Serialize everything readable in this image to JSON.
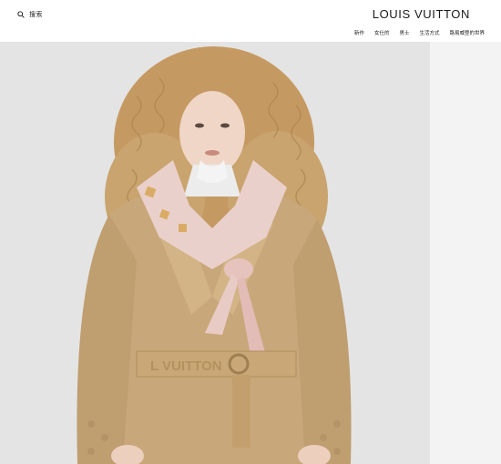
{
  "header": {
    "search_label": "搜索",
    "logo_text": "LOUIS VUITTON",
    "nav": [
      {
        "label": "新作"
      },
      {
        "label": "女仕的"
      },
      {
        "label": "男士"
      },
      {
        "label": "生活方式"
      },
      {
        "label": "路易威登的世界"
      }
    ]
  },
  "hero": {
    "alt": "Model wearing camel wool wrap coat with pink silk scarf",
    "belt_text": "L VUITTON",
    "colors": {
      "background": "#e3e3e3",
      "coat": "#c7a77a",
      "scarf": "#e9c9c4",
      "hair": "#c9a068",
      "sweater": "#ededed"
    }
  }
}
